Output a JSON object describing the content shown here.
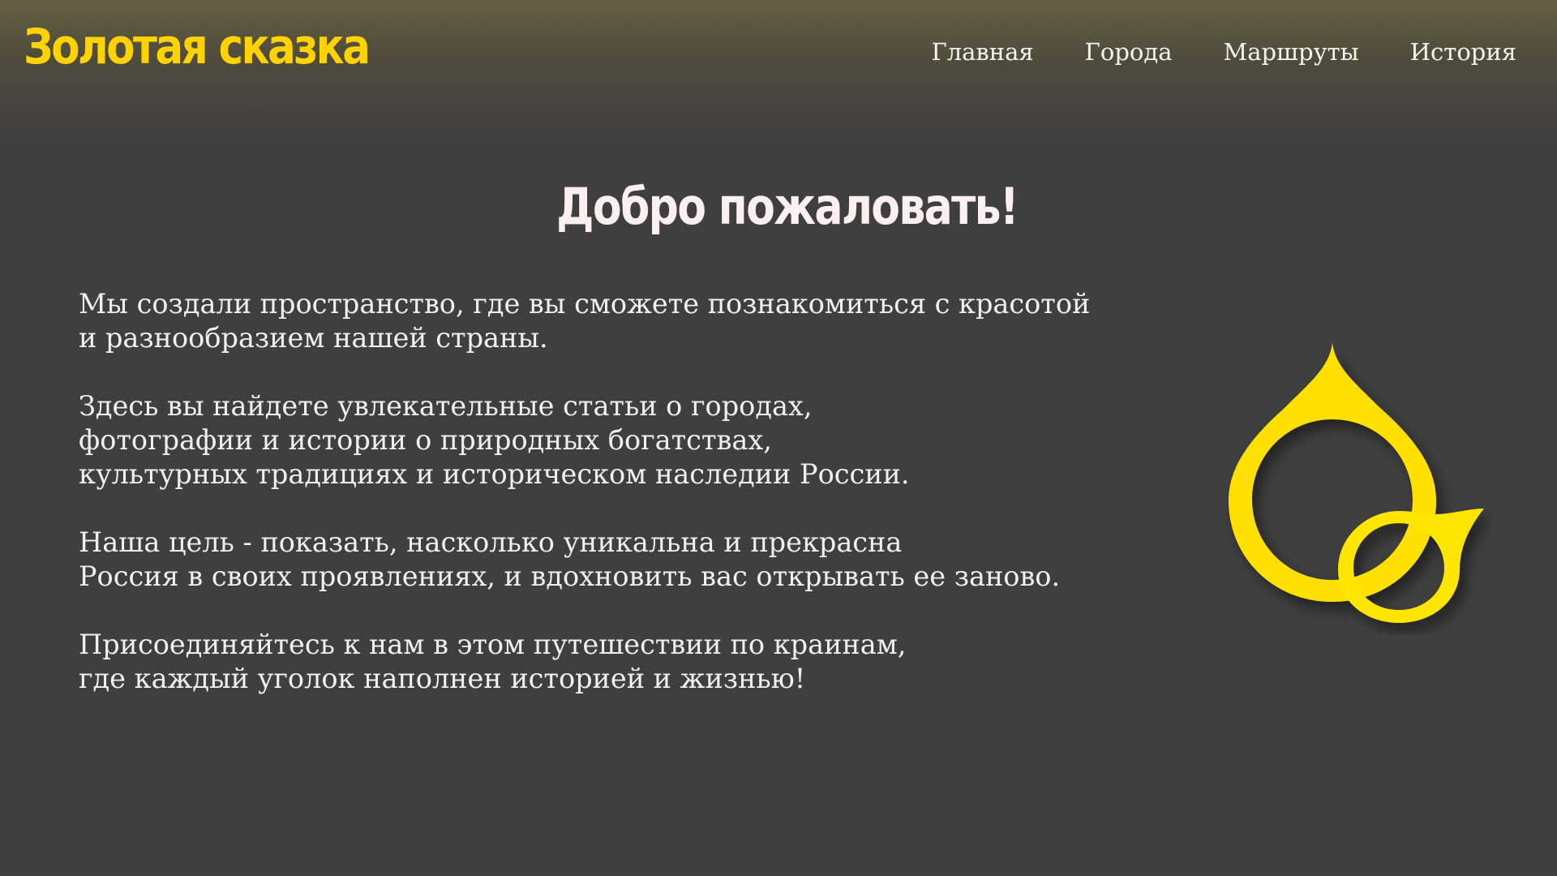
{
  "header": {
    "logo": "Золотая сказка",
    "nav": [
      {
        "label": "Главная"
      },
      {
        "label": "Города"
      },
      {
        "label": "Маршруты"
      },
      {
        "label": "История"
      }
    ]
  },
  "main": {
    "title": "Добро пожаловать!",
    "paragraphs": [
      {
        "lines": [
          "Мы создали пространство, где вы сможете познакомиться с красотой",
          "и разнообразием нашей страны."
        ]
      },
      {
        "lines": [
          "Здесь вы найдете увлекательные статьи о городах,",
          "фотографии и истории о природных богатствах,",
          "культурных традициях и историческом наследии России."
        ]
      },
      {
        "lines": [
          "Наша цель - показать, насколько уникальна и прекрасна",
          "Россия в своих проявлениях, и вдохновить вас открывать ее заново."
        ]
      },
      {
        "lines": [
          "Присоединяйтесь к нам в этом путешествии по краинам,",
          "где каждый уголок наполнен историей и жизнью!"
        ]
      }
    ]
  },
  "emblem": {
    "icon": "golden-rings-icon",
    "color": "#ffe000"
  },
  "colors": {
    "accent": "#ffd200",
    "background": "#3f3f3f",
    "text": "#f2f0ee"
  }
}
